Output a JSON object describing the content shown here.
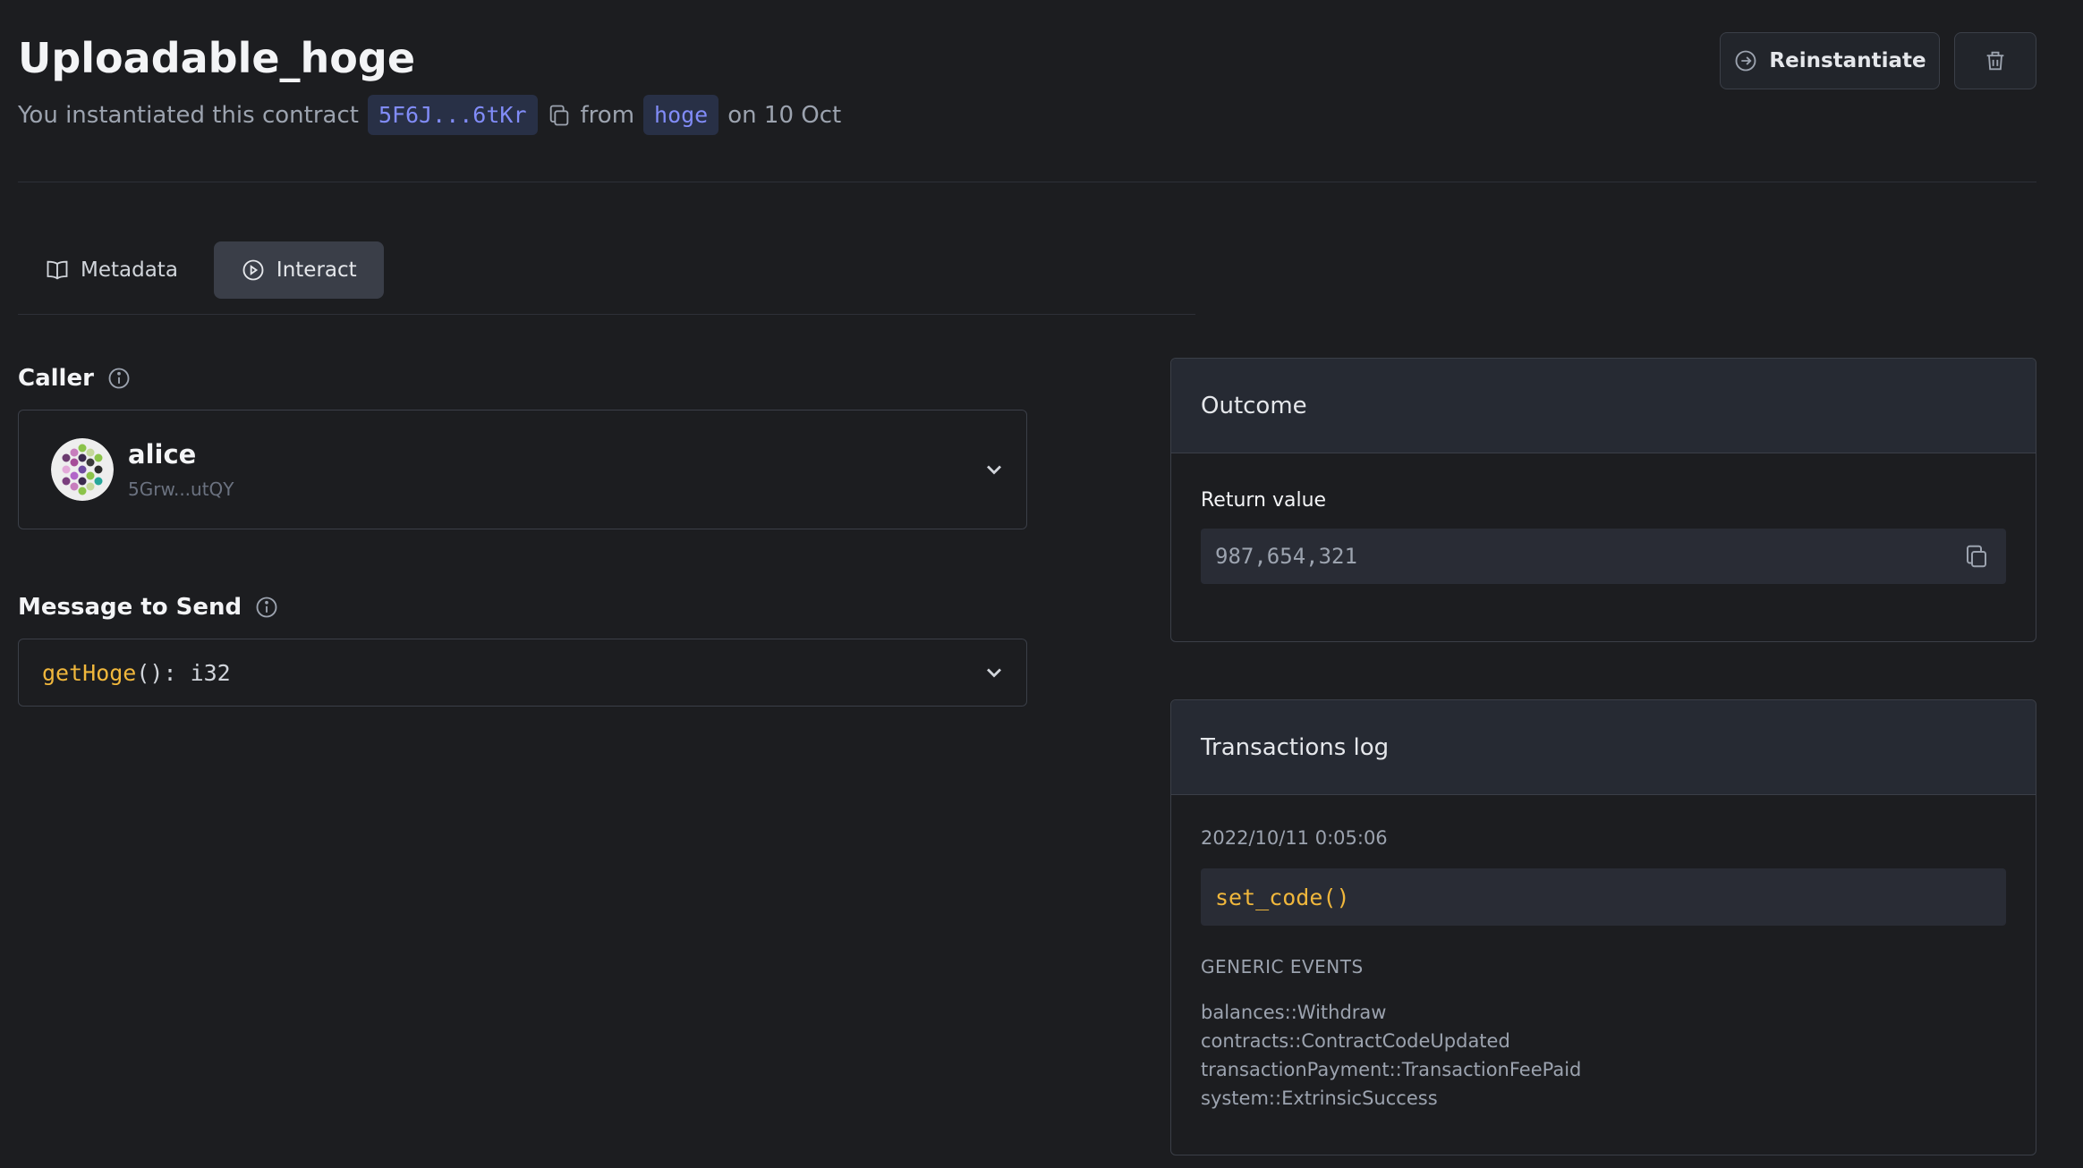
{
  "header": {
    "title": "Uploadable_hoge",
    "subtitle_prefix": "You instantiated this contract",
    "address_short": "5F6J...6tKr",
    "from_text": "from",
    "code_name": "hoge",
    "date_text": "on 10 Oct",
    "reinstantiate_label": "Reinstantiate"
  },
  "tabs": [
    {
      "label": "Metadata",
      "icon": "book-icon",
      "active": false
    },
    {
      "label": "Interact",
      "icon": "play-circle-icon",
      "active": true
    }
  ],
  "caller": {
    "label": "Caller",
    "name": "alice",
    "address": "5Grw...utQY"
  },
  "message": {
    "label": "Message to Send",
    "fn_name": "getHoge",
    "fn_rest": "(): i32"
  },
  "outcome": {
    "title": "Outcome",
    "return_label": "Return value",
    "return_value": "987,654,321"
  },
  "transactions": {
    "title": "Transactions log",
    "timestamp": "2022/10/11 0:05:06",
    "call": "set_code()",
    "events_title": "GENERIC EVENTS",
    "events": [
      "balances::Withdraw",
      "contracts::ContractCodeUpdated",
      "transactionPayment::TransactionFeePaid",
      "system::ExtrinsicSuccess"
    ]
  },
  "colors": {
    "background": "#1c1d20",
    "accent_indigo": "#818cf8",
    "function_yellow": "#f0b73c"
  }
}
